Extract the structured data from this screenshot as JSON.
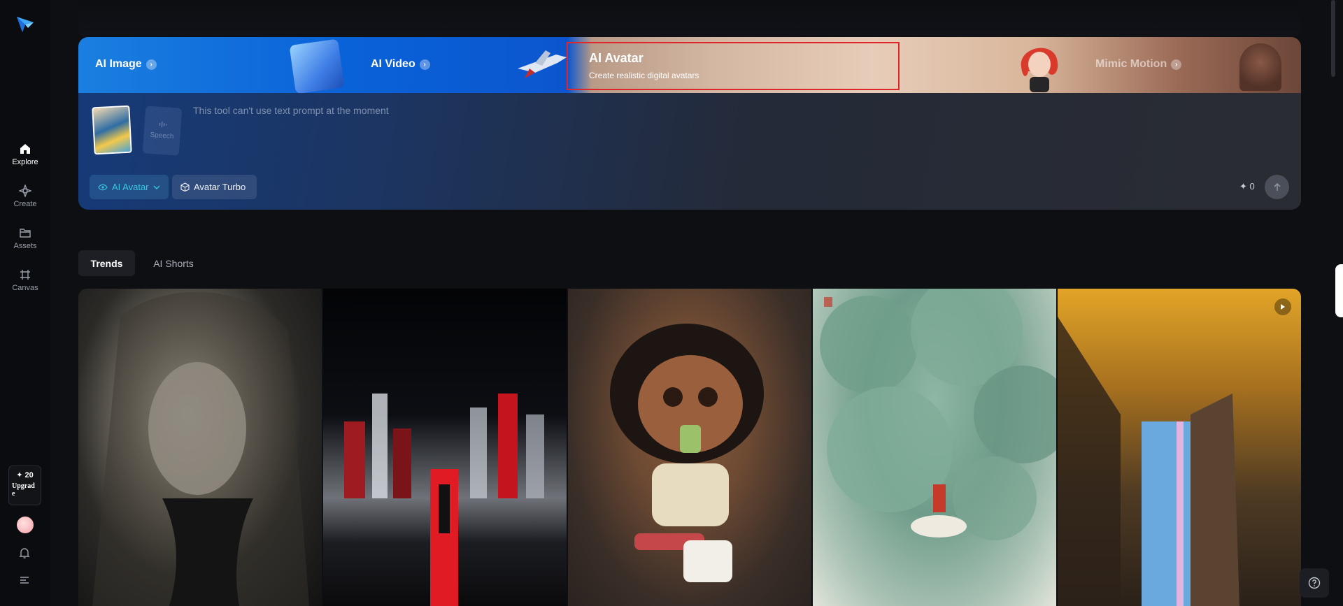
{
  "sidebar": {
    "nav": [
      {
        "label": "Explore",
        "icon": "home-icon"
      },
      {
        "label": "Create",
        "icon": "sparkle-icon"
      },
      {
        "label": "Assets",
        "icon": "folder-icon"
      },
      {
        "label": "Canvas",
        "icon": "canvas-icon"
      }
    ],
    "credits": "✦ 20",
    "upgrade_label": "Upgrade"
  },
  "tool_tabs": {
    "image": "AI Image",
    "video": "AI Video",
    "avatar_title": "AI Avatar",
    "avatar_subtitle": "Create realistic digital avatars",
    "mimic": "Mimic Motion"
  },
  "prompt": {
    "placeholder": "This tool can't use text prompt at the moment",
    "speech_label": "Speech",
    "mode_chip": "AI Avatar",
    "model_chip": "Avatar Turbo",
    "cost": "✦ 0"
  },
  "feed": {
    "tabs": [
      "Trends",
      "AI Shorts"
    ]
  },
  "colors": {
    "accent": "#38c6e0",
    "highlight": "#e0252b"
  }
}
